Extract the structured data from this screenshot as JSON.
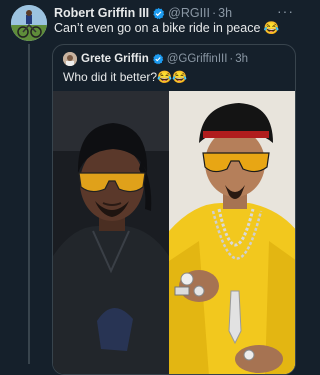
{
  "tweet": {
    "author_name": "Robert Griffin III",
    "handle": "@RGIII",
    "separator": "·",
    "time": "3h",
    "text": "Can’t even go on a bike ride in peace 😂",
    "more_icon": "more-horizontal-icon"
  },
  "quoted_tweet": {
    "author_name": "Grete Griffin",
    "handle": "@GGriffinIII",
    "separator": "·",
    "time": "3h",
    "text": "Who did it better?😂😂"
  },
  "colors": {
    "background": "#15202b",
    "verified_blue": "#1d9bf0",
    "secondary_text": "#8b98a5",
    "border": "#38444d"
  }
}
